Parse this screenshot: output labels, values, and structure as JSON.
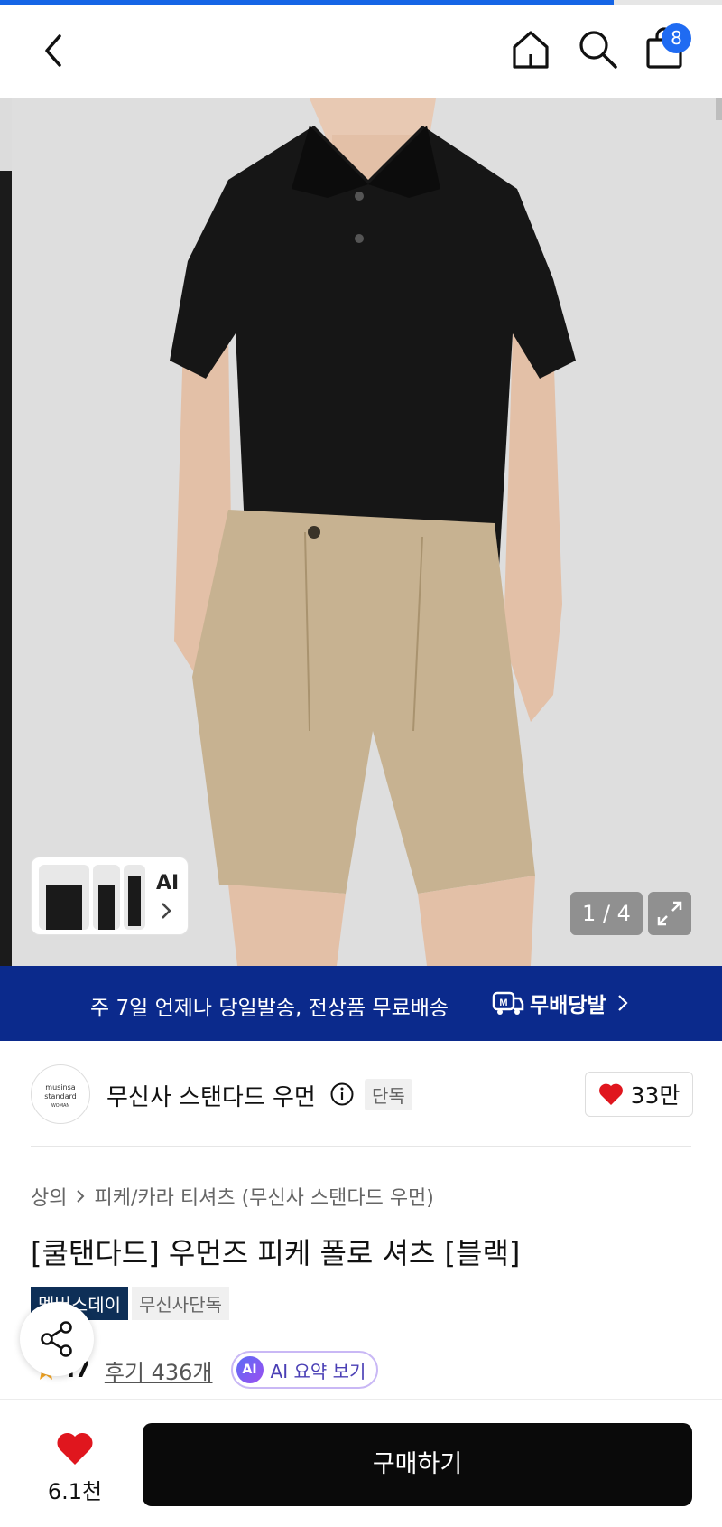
{
  "top_bar": {
    "progress": 0.85,
    "cart_count": "8",
    "icons": [
      "back-arrow-icon",
      "home-icon",
      "search-icon",
      "shopping-bag-icon"
    ]
  },
  "gallery": {
    "counter": "1 / 4",
    "ai_label": "AI",
    "icons": [
      "expand-icon",
      "chevron-right-icon"
    ]
  },
  "banner": {
    "text": "주 7일 언제나 당일발송, 전상품 무료배송",
    "brand": "무배당발",
    "brand_mark": "M"
  },
  "store": {
    "logo_line1": "musinsa",
    "logo_line2": "standard",
    "logo_line3": "WOMAN",
    "name": "무신사 스탠다드 우먼",
    "exclusive_tag": "단독",
    "likes": "33만"
  },
  "product": {
    "breadcrumb_category": "상의",
    "breadcrumb_sub": "피케/카라 티셔츠 (무신사 스탠다드 우먼)",
    "title": "[쿨탠다드] 우먼즈 피케 폴로 셔츠 [블랙]",
    "tags": [
      "멤버스데이",
      "무신사단독"
    ],
    "rating": ".7",
    "reviews": "후기 436개",
    "ai_badge": "AI",
    "ai_summary": "AI 요약 보기"
  },
  "bottom_bar": {
    "wish_count": "6.1천",
    "buy_label": "구매하기"
  },
  "colors": {
    "accent_blue": "#1f6bf2",
    "banner_navy": "#0b2a8c",
    "heart_red": "#e0161e",
    "buy_black": "#0a0a0a"
  }
}
